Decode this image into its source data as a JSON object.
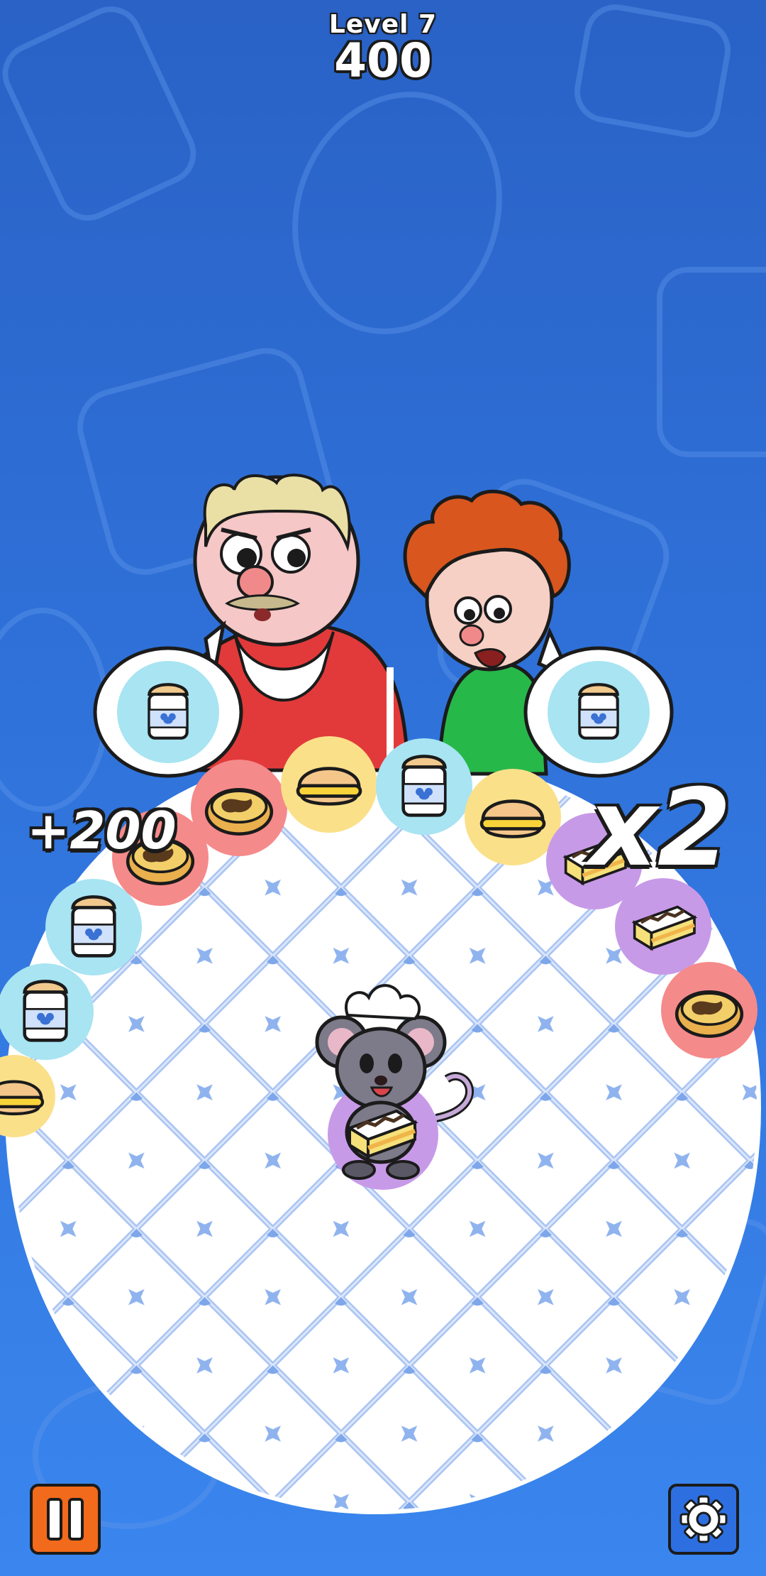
{
  "hud": {
    "level_label": "Level 7",
    "score": "400"
  },
  "popups": {
    "bonus": "+200",
    "multiplier": "x2"
  },
  "customers": [
    {
      "name": "old-man",
      "order_icon": "milk-jar-pastry-icon"
    },
    {
      "name": "curly-boy",
      "order_icon": "milk-jar-pastry-icon"
    }
  ],
  "conveyor_items": [
    "bun-icon",
    "milk-jar-pastry-icon",
    "milk-jar-pastry-icon",
    "pie-icon",
    "pie-icon",
    "bun-icon",
    "milk-jar-pastry-icon",
    "bun-icon",
    "layer-cake-icon",
    "layer-cake-icon",
    "pie-icon"
  ],
  "player": {
    "character": "chef-mouse",
    "holding": "layer-cake-icon"
  },
  "controls": {
    "pause_icon": "pause-icon",
    "settings_icon": "gear-icon"
  },
  "colors": {
    "sky": "#2f72da",
    "pie_ring": "#f58a8a",
    "bun_ring": "#fbe08a",
    "milk_ring": "#a8e4f2",
    "cake_ring": "#c79ae8",
    "pause": "#f26a1b",
    "settings": "#2d6fe0"
  }
}
